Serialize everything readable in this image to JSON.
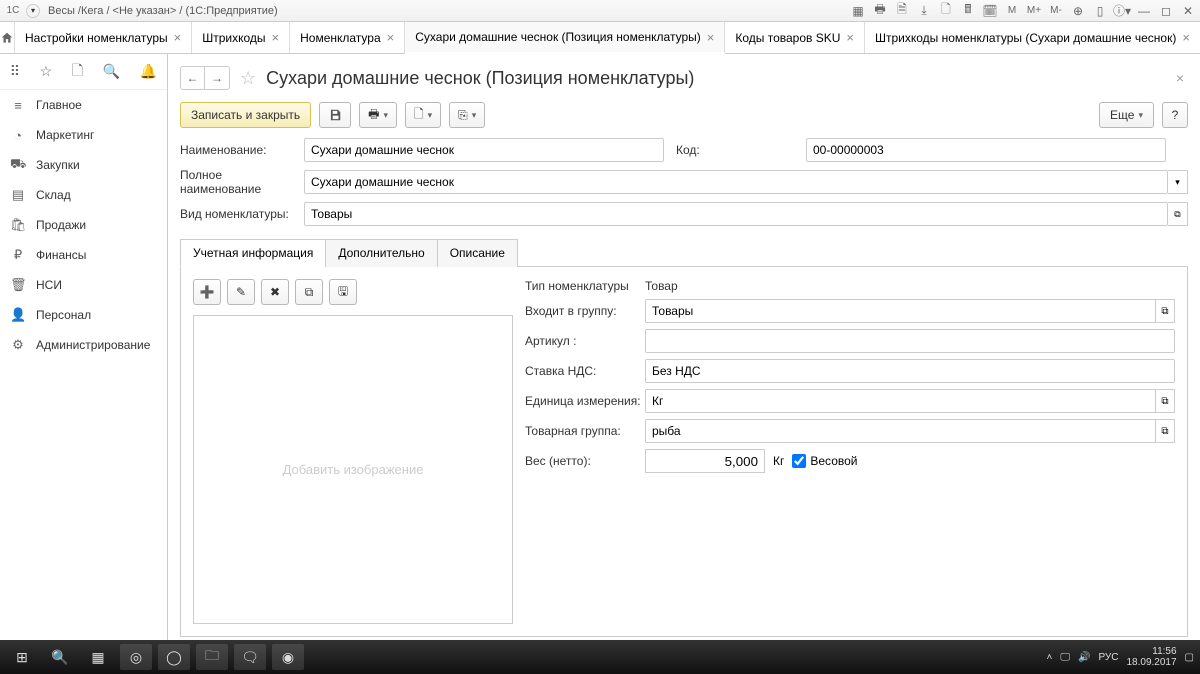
{
  "titlebar": {
    "logo": "1C",
    "path": "Весы /Кега / <Не указан> /  (1С:Предприятие)"
  },
  "tabs": [
    {
      "label": "Настройки номенклатуры",
      "closable": true
    },
    {
      "label": "Штрихкоды",
      "closable": true
    },
    {
      "label": "Номенклатура",
      "closable": true
    },
    {
      "label": "Сухари домашние чеснок (Позиция номенклатуры)",
      "closable": true,
      "active": true
    },
    {
      "label": "Коды товаров SKU",
      "closable": true
    },
    {
      "label": "Штрихкоды номенклатуры (Сухари домашние чеснок)",
      "closable": true
    }
  ],
  "sidebar": {
    "items": [
      {
        "icon": "≡",
        "label": "Главное"
      },
      {
        "icon": "◔",
        "label": "Маркетинг"
      },
      {
        "icon": "⛟",
        "label": "Закупки"
      },
      {
        "icon": "▤",
        "label": "Склад"
      },
      {
        "icon": "🛍",
        "label": "Продажи"
      },
      {
        "icon": "₽",
        "label": "Финансы"
      },
      {
        "icon": "🗑",
        "label": "НСИ"
      },
      {
        "icon": "👤",
        "label": "Персонал"
      },
      {
        "icon": "⚙",
        "label": "Администрирование"
      }
    ]
  },
  "page": {
    "title": "Сухари домашние чеснок (Позиция номенклатуры)"
  },
  "toolbar": {
    "save_close": "Записать и закрыть",
    "more": "Еще",
    "help": "?"
  },
  "form": {
    "name_label": "Наименование:",
    "name_value": "Сухари домашние чеснок",
    "code_label": "Код:",
    "code_value": "00-00000003",
    "fullname_label": "Полное наименование",
    "fullname_value": "Сухари домашние чеснок",
    "type_label": "Вид номенклатуры:",
    "type_value": "Товары"
  },
  "dtabs": [
    {
      "label": "Учетная информация",
      "active": true
    },
    {
      "label": "Дополнительно"
    },
    {
      "label": "Описание"
    }
  ],
  "image": {
    "placeholder": "Добавить изображение"
  },
  "props": {
    "type_label": "Тип номенклатуры",
    "type_value": "Товар",
    "group_label": "Входит в группу:",
    "group_value": "Товары",
    "article_label": "Артикул :",
    "article_value": "",
    "vat_label": "Ставка НДС:",
    "vat_value": "Без НДС",
    "unit_label": "Единица измерения:",
    "unit_value": "Кг",
    "tgroup_label": "Товарная группа:",
    "tgroup_value": "рыба",
    "weightnet_label": "Вес (нетто):",
    "weightnet_value": "5,000",
    "weight_unit": "Кг",
    "weight_chk_label": "Весовой",
    "weight_chk": true
  },
  "taskbar": {
    "time": "11:56",
    "date": "18.09.2017",
    "lang": "РУС"
  }
}
